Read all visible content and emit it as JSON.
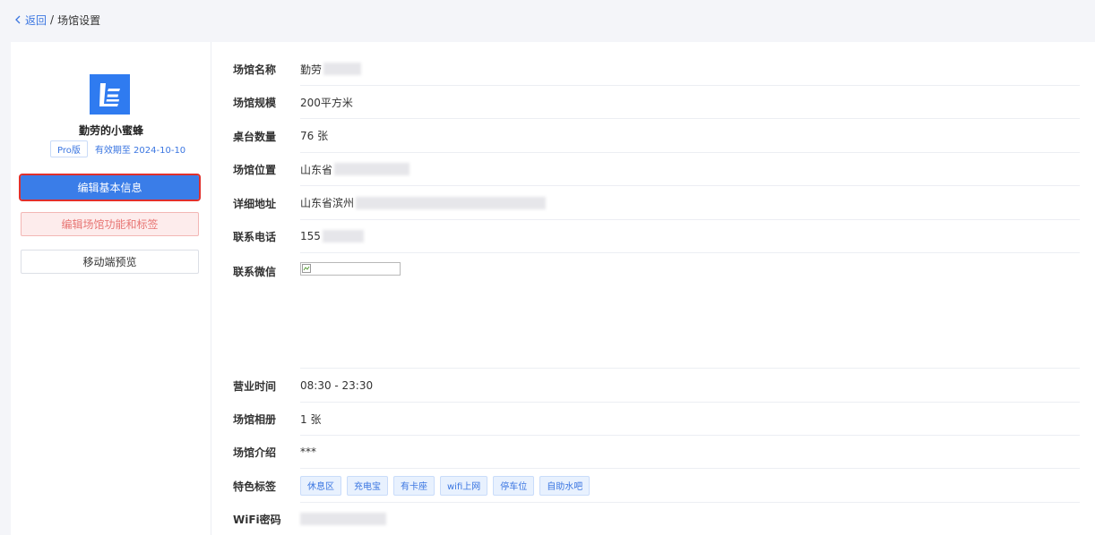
{
  "breadcrumb": {
    "back_label": "返回",
    "separator": "/",
    "current": "场馆设置"
  },
  "venue": {
    "name": "勤劳的小蜜蜂",
    "plan": "Pro版",
    "expiry": "有效期至 2024-10-10"
  },
  "actions": {
    "edit_basic": "编辑基本信息",
    "edit_features": "编辑场馆功能和标签",
    "mobile_preview": "移动端预览"
  },
  "fields": {
    "name": {
      "label": "场馆名称",
      "value": "勤劳"
    },
    "scale": {
      "label": "场馆规模",
      "value": "200平方米"
    },
    "tables": {
      "label": "桌台数量",
      "value": "76 张"
    },
    "location": {
      "label": "场馆位置",
      "value": "山东省"
    },
    "address": {
      "label": "详细地址",
      "value": "山东省滨州"
    },
    "phone": {
      "label": "联系电话",
      "value": "155"
    },
    "wechat": {
      "label": "联系微信"
    },
    "hours": {
      "label": "营业时间",
      "value": "08:30 - 23:30"
    },
    "album": {
      "label": "场馆相册",
      "value": "1 张"
    },
    "intro": {
      "label": "场馆介绍",
      "value": "***"
    },
    "tags": {
      "label": "特色标签",
      "items": [
        "休息区",
        "充电宝",
        "有卡座",
        "wifi上网",
        "停车位",
        "自助水吧"
      ]
    },
    "wifi": {
      "label": "WiFi密码"
    }
  },
  "colors": {
    "accent": "#3a7de8",
    "highlight": "#e0302c",
    "warn_text": "#e87674"
  }
}
